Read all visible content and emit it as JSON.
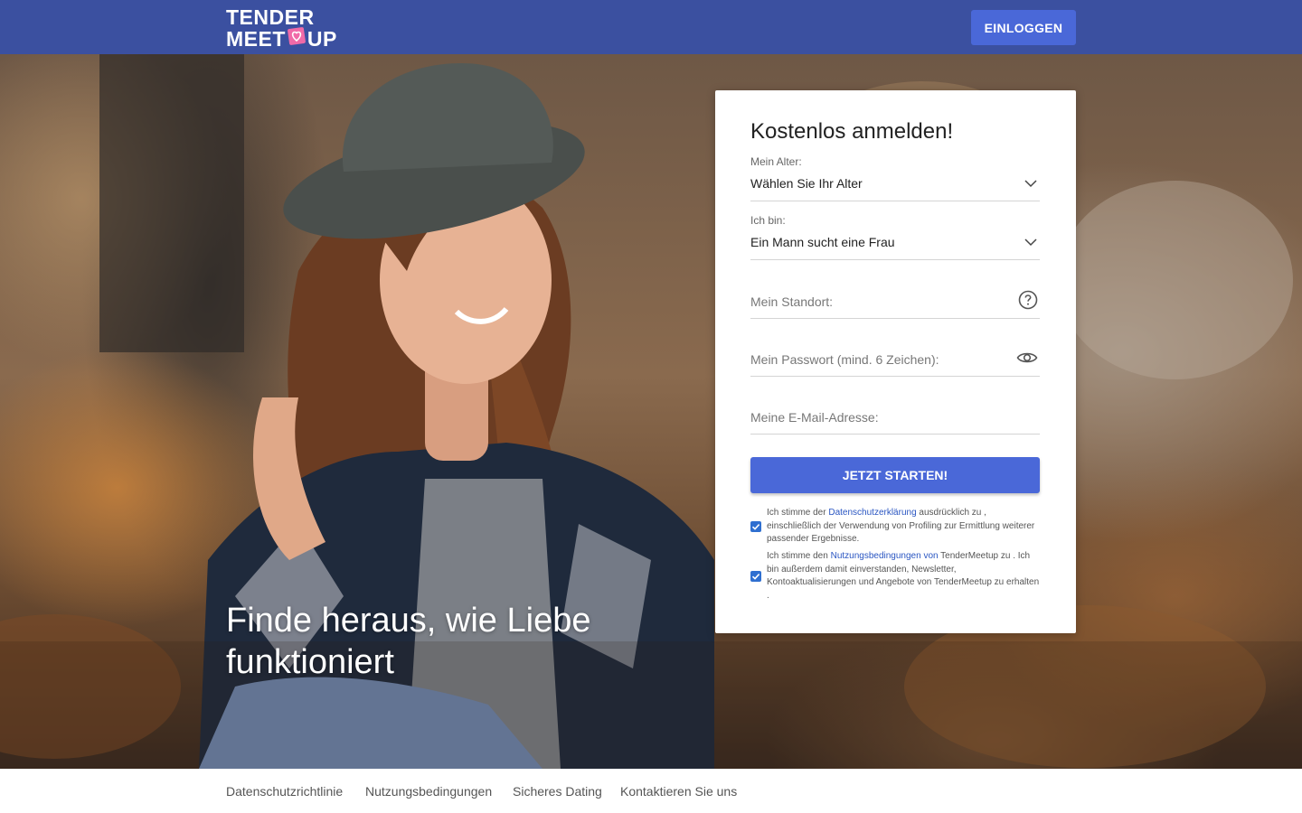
{
  "header": {
    "logo_line1": "TENDER",
    "logo_line2_left": "MEET",
    "logo_line2_right": "UP",
    "login_label": "EINLOGGEN"
  },
  "hero": {
    "tagline": "Finde heraus, wie Liebe funktioniert"
  },
  "form": {
    "title": "Kostenlos anmelden!",
    "age": {
      "label": "Mein Alter:",
      "value": "Wählen Sie Ihr Alter"
    },
    "gender": {
      "label": "Ich bin:",
      "value": "Ein Mann sucht eine Frau"
    },
    "location": {
      "placeholder": "Mein Standort:"
    },
    "password": {
      "placeholder": "Mein Passwort (mind. 6 Zeichen):"
    },
    "email": {
      "placeholder": "Meine E-Mail-Adresse:"
    },
    "submit_label": "JETZT STARTEN!",
    "consent1": {
      "checked": true,
      "pre": "Ich stimme der ",
      "link": "Datenschutzerklärung",
      "post": " ausdrücklich zu , einschließlich der Verwendung von Profiling zur Ermittlung weiterer passender Ergebnisse."
    },
    "consent2": {
      "checked": true,
      "pre": "Ich stimme den ",
      "link": "Nutzungsbedingungen von",
      "post": " TenderMeetup zu . Ich bin außerdem damit einverstanden, Newsletter, Kontoaktualisierungen und Angebote von TenderMeetup zu erhalten ."
    }
  },
  "footer": {
    "links": [
      "Datenschutzrichtlinie",
      "Nutzungsbedingungen",
      "Sicheres Dating",
      "Kontaktieren Sie uns"
    ]
  },
  "icons": {
    "age_dropdown": "chevron-down-icon",
    "gender_dropdown": "chevron-down-icon",
    "location_help": "question-circle-icon",
    "password_toggle": "eye-icon",
    "logo_mark": "heart-icon"
  },
  "colors": {
    "header_bg": "#3b50a0",
    "button_bg": "#4a68d8",
    "link": "#2a56c2",
    "checkbox": "#2f6fd0",
    "logo_heart": "#f06aa8"
  }
}
